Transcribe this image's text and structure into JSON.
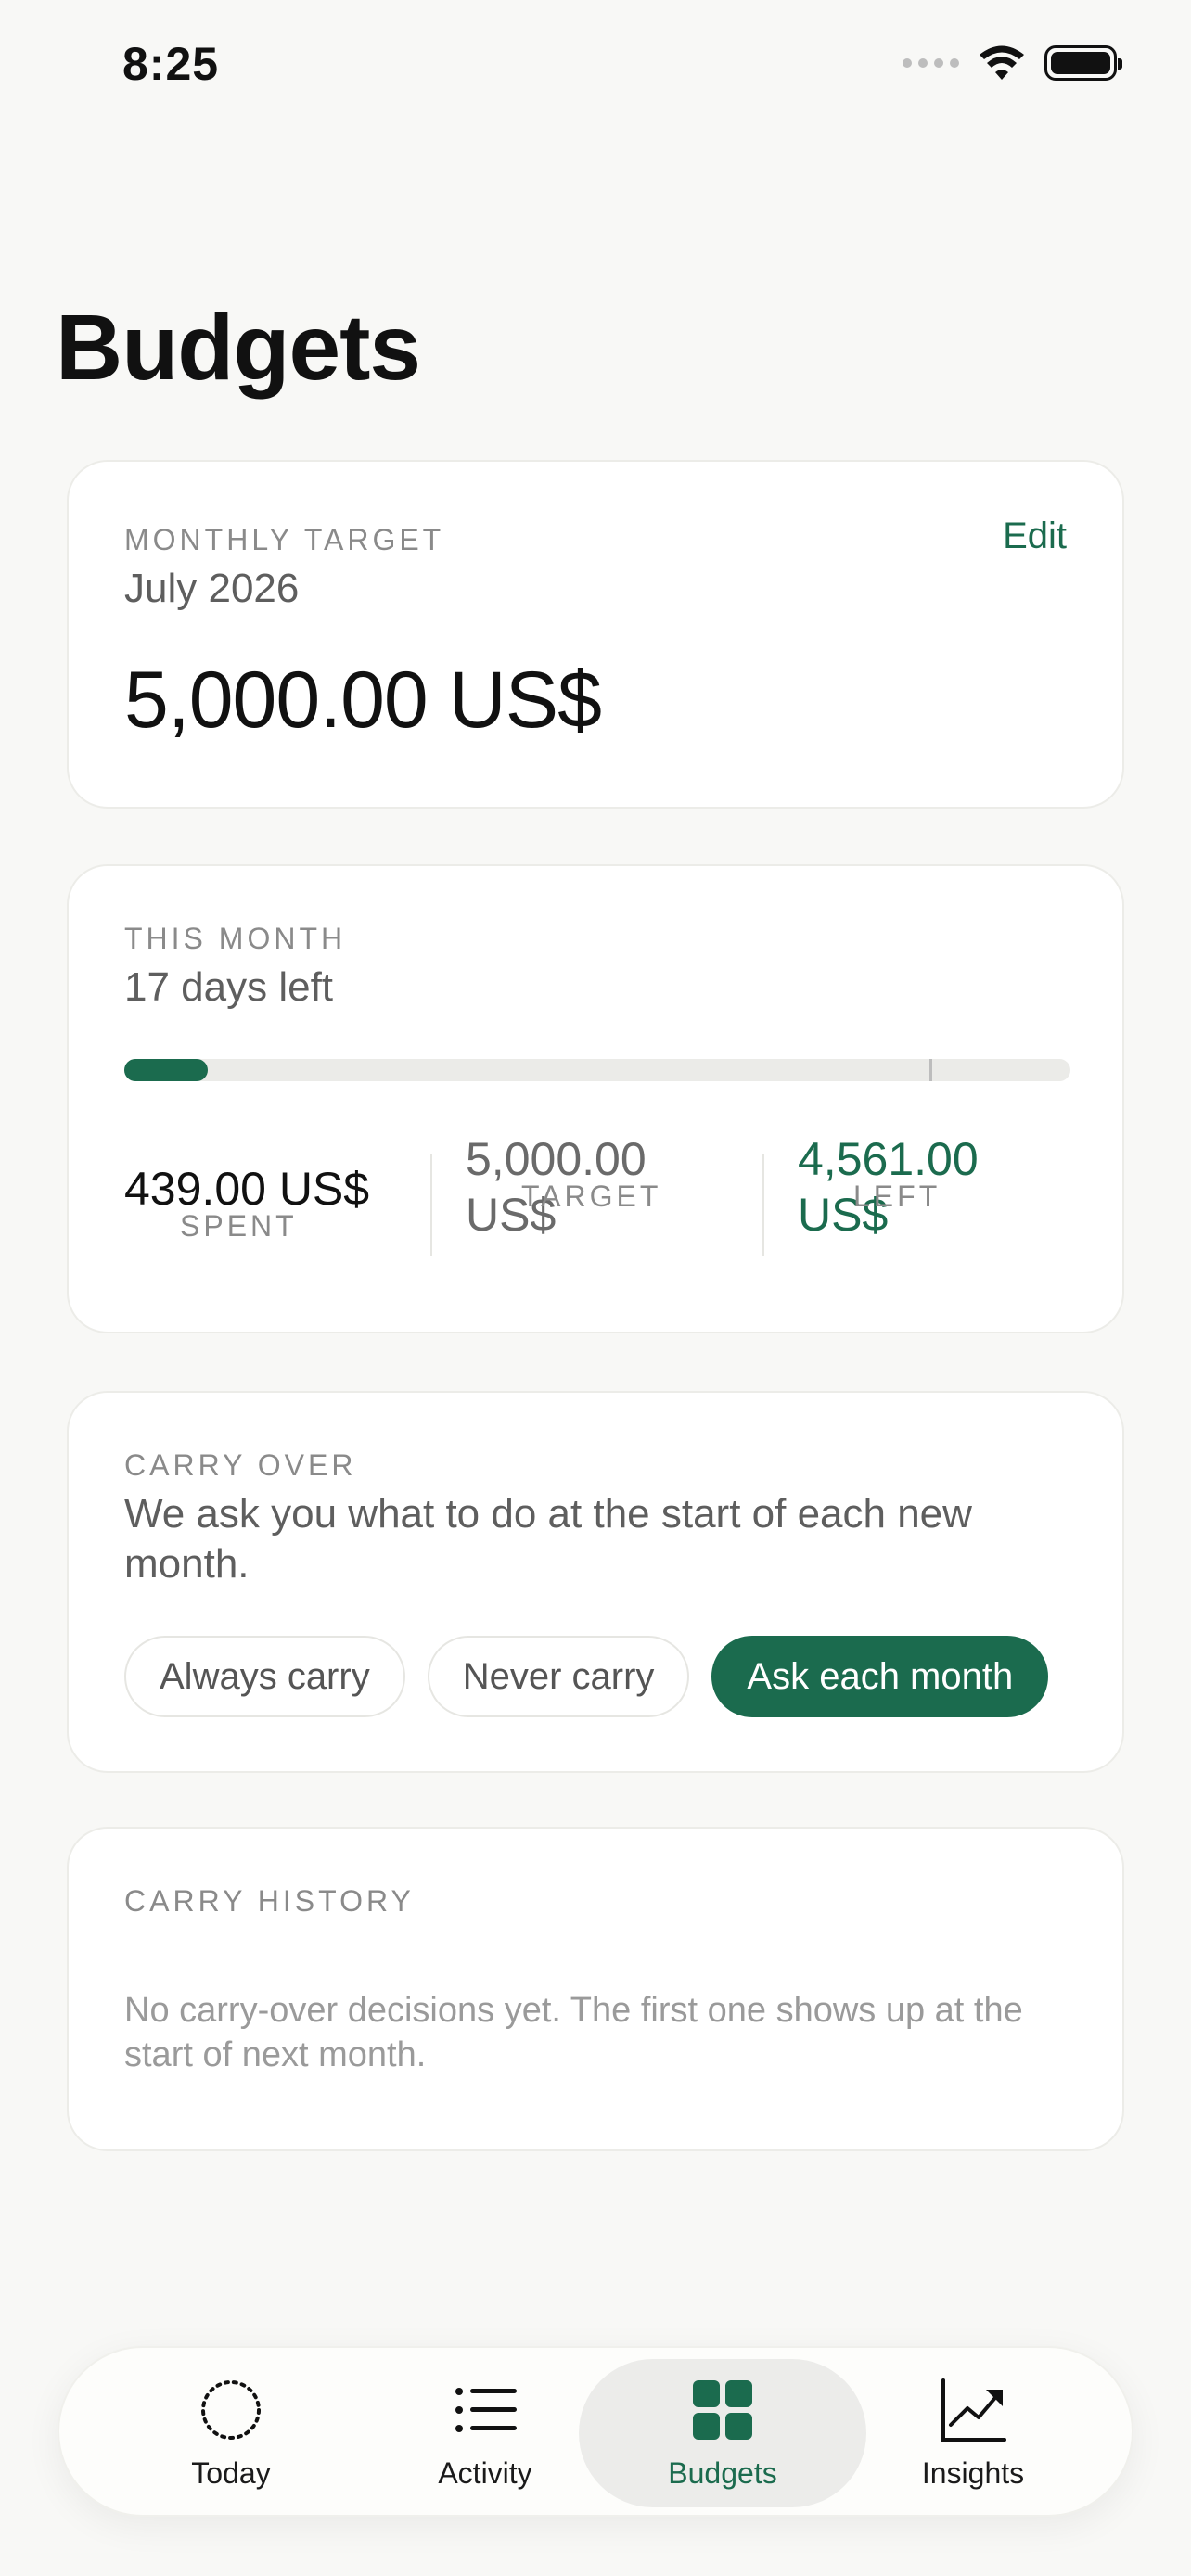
{
  "status_bar": {
    "time": "8:25"
  },
  "page": {
    "title": "Budgets"
  },
  "target_card": {
    "label": "MONTHLY TARGET",
    "period": "July 2026",
    "edit_label": "Edit",
    "amount": "5,000.00 US$"
  },
  "month_card": {
    "label": "THIS MONTH",
    "days_left": "17 days left",
    "progress_fraction": 0.088,
    "spent_label": "SPENT",
    "spent_value": "439.00 US$",
    "target_label": "TARGET",
    "target_value": "5,000.00 US$",
    "left_label": "LEFT",
    "left_value": "4,561.00 US$"
  },
  "carry_card": {
    "label": "CARRY OVER",
    "description": "We ask you what to do at the start of each new month.",
    "options": [
      "Always carry",
      "Never carry",
      "Ask each month"
    ],
    "selected": "Ask each month"
  },
  "history_card": {
    "label": "CARRY HISTORY",
    "empty_text": "No carry-over decisions yet. The first one shows up at the start of next month."
  },
  "tab_bar": {
    "tabs": [
      {
        "label": "Today",
        "icon": "dotted-circle-icon"
      },
      {
        "label": "Activity",
        "icon": "list-icon"
      },
      {
        "label": "Budgets",
        "icon": "grid-icon"
      },
      {
        "label": "Insights",
        "icon": "chart-trend-icon"
      }
    ],
    "active": "Budgets"
  },
  "colors": {
    "accent": "#1b6b4e",
    "background": "#f8f8f6",
    "card": "#ffffff"
  }
}
